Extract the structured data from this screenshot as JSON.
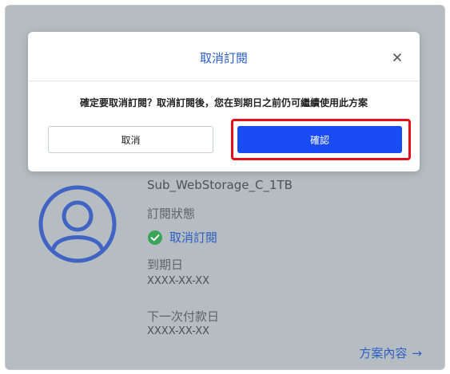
{
  "plan": {
    "name": "Sub_WebStorage_C_1TB",
    "status_label": "訂閱狀態",
    "status_value": "取消訂閱",
    "expiry_label": "到期日",
    "expiry_value": "XXXX-XX-XX",
    "next_payment_label": "下一次付款日",
    "next_payment_value": "XXXX-XX-XX",
    "details_link": "方案內容",
    "details_arrow": "→"
  },
  "modal": {
    "title": "取消訂閱",
    "close_icon": "×",
    "message": "確定要取消訂閱？取消訂閱後，您在到期日之前仍可繼續使用此方案",
    "cancel_label": "取消",
    "confirm_label": "確認"
  },
  "colors": {
    "backdrop": "#b5bdc2",
    "accent": "#1a4cf5",
    "link": "#2e5ec2",
    "highlight": "#e6101a",
    "status_ok": "#3aa55a"
  },
  "icons": {
    "avatar": "user-avatar-icon",
    "status": "check-circle-icon",
    "close": "close-icon"
  }
}
